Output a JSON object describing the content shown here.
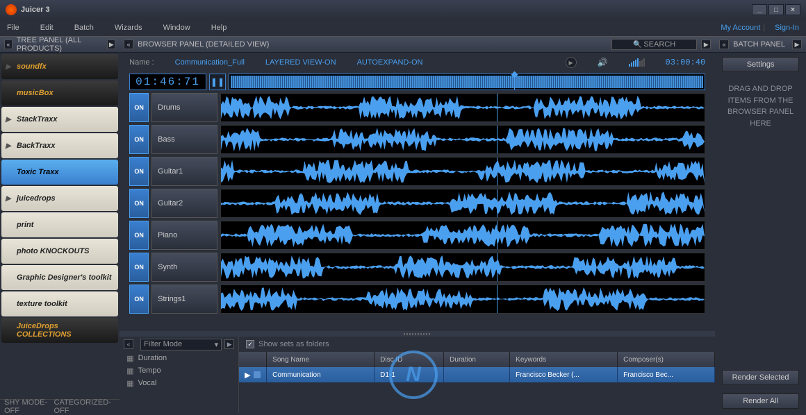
{
  "app": {
    "title": "Juicer 3"
  },
  "menu": [
    "File",
    "Edit",
    "Batch",
    "Wizards",
    "Window",
    "Help"
  ],
  "account": {
    "my_account": "My Account",
    "sign_in": "Sign-In"
  },
  "left": {
    "title": "TREE PANEL (ALL PRODUCTS)",
    "products": [
      {
        "label": "soundfx",
        "dark": true,
        "arrow": true
      },
      {
        "label": "musicBox",
        "dark": true,
        "arrow": false
      },
      {
        "label": "StackTraxx",
        "dark": false,
        "arrow": true
      },
      {
        "label": "BackTraxx",
        "dark": false,
        "arrow": true
      },
      {
        "label": "Toxic Traxx",
        "dark": false,
        "arrow": false,
        "selected": true
      },
      {
        "label": "juicedrops",
        "dark": false,
        "arrow": true
      },
      {
        "label": "print",
        "dark": false,
        "arrow": false
      },
      {
        "label": "photo KNOCKOUTS",
        "dark": false,
        "arrow": false
      },
      {
        "label": "Graphic Designer's toolkit",
        "dark": false,
        "arrow": false
      },
      {
        "label": "texture toolkit",
        "dark": false,
        "arrow": false
      },
      {
        "label": "JuiceDrops COLLECTIONS",
        "dark": true,
        "arrow": false
      }
    ],
    "footer": {
      "shy": "SHY MODE-OFF",
      "cat": "CATEGORIZED-OFF"
    }
  },
  "center": {
    "title": "BROWSER PANEL (DETAILED VIEW)",
    "search": "SEARCH",
    "name_label": "Name :",
    "name_value": "Communication_Full",
    "layered": "LAYERED VIEW-ON",
    "autoexpand": "AUTOEXPAND-ON",
    "duration": "03:00:40",
    "timecode": "01:46:71",
    "tracks": [
      {
        "on": "ON",
        "name": "Drums"
      },
      {
        "on": "ON",
        "name": "Bass"
      },
      {
        "on": "ON",
        "name": "Guitar1"
      },
      {
        "on": "ON",
        "name": "Guitar2"
      },
      {
        "on": "ON",
        "name": "Piano"
      },
      {
        "on": "ON",
        "name": "Synth"
      },
      {
        "on": "ON",
        "name": "Strings1"
      }
    ]
  },
  "bottom": {
    "filter_mode": "Filter Mode",
    "filters": [
      "Duration",
      "Tempo",
      "Vocal"
    ],
    "show_sets": "Show sets as folders",
    "columns": {
      "song": "Song Name",
      "disc": "Disc ID",
      "dur": "Duration",
      "kw": "Keywords",
      "comp": "Composer(s)"
    },
    "row": {
      "song": "Communication",
      "disc": "D1-1",
      "dur": "",
      "kw": "Francisco Becker (...",
      "comp": "Francisco Bec..."
    }
  },
  "right": {
    "title": "BATCH PANEL",
    "settings": "Settings",
    "drop_msg": "DRAG AND DROP ITEMS FROM THE BROWSER PANEL HERE",
    "render_sel": "Render Selected",
    "render_all": "Render All"
  }
}
